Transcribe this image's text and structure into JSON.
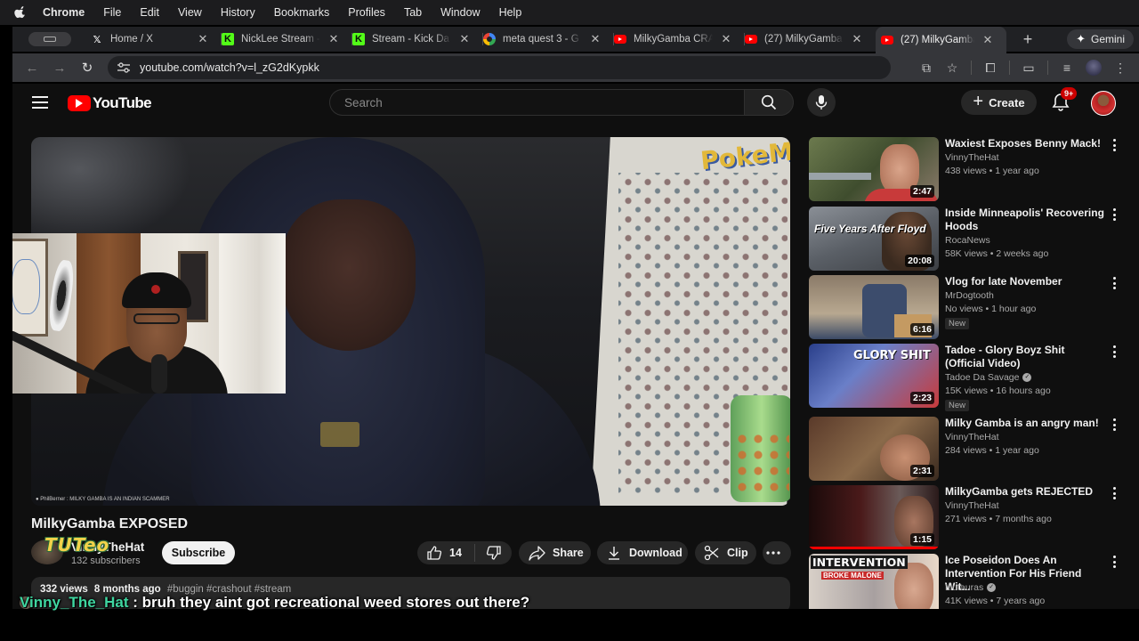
{
  "menubar": {
    "app": "Chrome",
    "items": [
      "File",
      "Edit",
      "View",
      "History",
      "Bookmarks",
      "Profiles",
      "Tab",
      "Window",
      "Help"
    ]
  },
  "tabs": [
    {
      "label": "Home / X",
      "icon": "x-logo-icon"
    },
    {
      "label": "NickLee Stream -",
      "icon": "kick-logo-icon"
    },
    {
      "label": "Stream - Kick Da",
      "icon": "kick-logo-icon"
    },
    {
      "label": "meta quest 3 - G",
      "icon": "google-logo-icon"
    },
    {
      "label": "MilkyGamba CRA",
      "icon": "youtube-logo-icon"
    },
    {
      "label": "(27) MilkyGamba",
      "icon": "youtube-logo-icon"
    },
    {
      "label": "(27) MilkyGamba",
      "icon": "youtube-logo-icon",
      "active": true
    }
  ],
  "gemini_label": "Gemini",
  "address": {
    "url": "youtube.com/watch?v=l_zG2dKypkk"
  },
  "youtube": {
    "logo_text": "YouTube",
    "search_placeholder": "Search",
    "create_label": "Create",
    "notification_badge": "9+"
  },
  "video": {
    "ticker_text": "● PhilBerner : MILKY GAMBA IS AN INDIAN SCAMMER",
    "poster_text": "PokeMo",
    "title": "MilkyGamba EXPOSED",
    "channel_name": "VinnyTheHat",
    "subscribers": "132 subscribers",
    "overlay_logo_text": "TUTeo",
    "subscribe_label": "Subscribe",
    "likes": "14",
    "share_label": "Share",
    "download_label": "Download",
    "clip_label": "Clip",
    "views": "332 views",
    "age": "8 months ago",
    "tags": "#buggin #crashout #stream"
  },
  "chat_overlay": {
    "username": "Vinny_The_Hat",
    "separator": ":",
    "message": "bruh they aint got recreational weed stores out there?"
  },
  "recommendations": [
    {
      "title": "Waxiest Exposes Benny Mack!",
      "channel": "VinnyTheHat",
      "meta": "438 views • 1 year ago",
      "duration": "2:47"
    },
    {
      "title": "Inside Minneapolis' Recovering Hoods",
      "channel": "RocaNews",
      "meta": "58K views • 2 weeks ago",
      "duration": "20:08",
      "thumb_text": "Five Years After Floyd"
    },
    {
      "title": "Vlog for late November",
      "channel": "MrDogtooth",
      "meta": "No views • 1 hour ago",
      "duration": "6:16",
      "badge": "New"
    },
    {
      "title": "Tadoe - Glory Boyz Shit (Official Video)",
      "channel": "Tadoe Da Savage",
      "meta": "15K views • 16 hours ago",
      "duration": "2:23",
      "badge": "New",
      "thumb_text": "GLORY SHIT"
    },
    {
      "title": "Milky Gamba is an angry man!",
      "channel": "VinnyTheHat",
      "meta": "284 views • 1 year ago",
      "duration": "2:31"
    },
    {
      "title": "MilkyGamba gets REJECTED",
      "channel": "VinnyTheHat",
      "meta": "271 views • 7 months ago",
      "duration": "1:15"
    },
    {
      "title": "Ice Poseidon Does An Intervention For His Friend Wit...",
      "channel": "Liutauras",
      "meta": "41K views • 7 years ago",
      "thumb_text": "INTERVENTION",
      "thumb_text2": "BROKE MALONE"
    }
  ]
}
